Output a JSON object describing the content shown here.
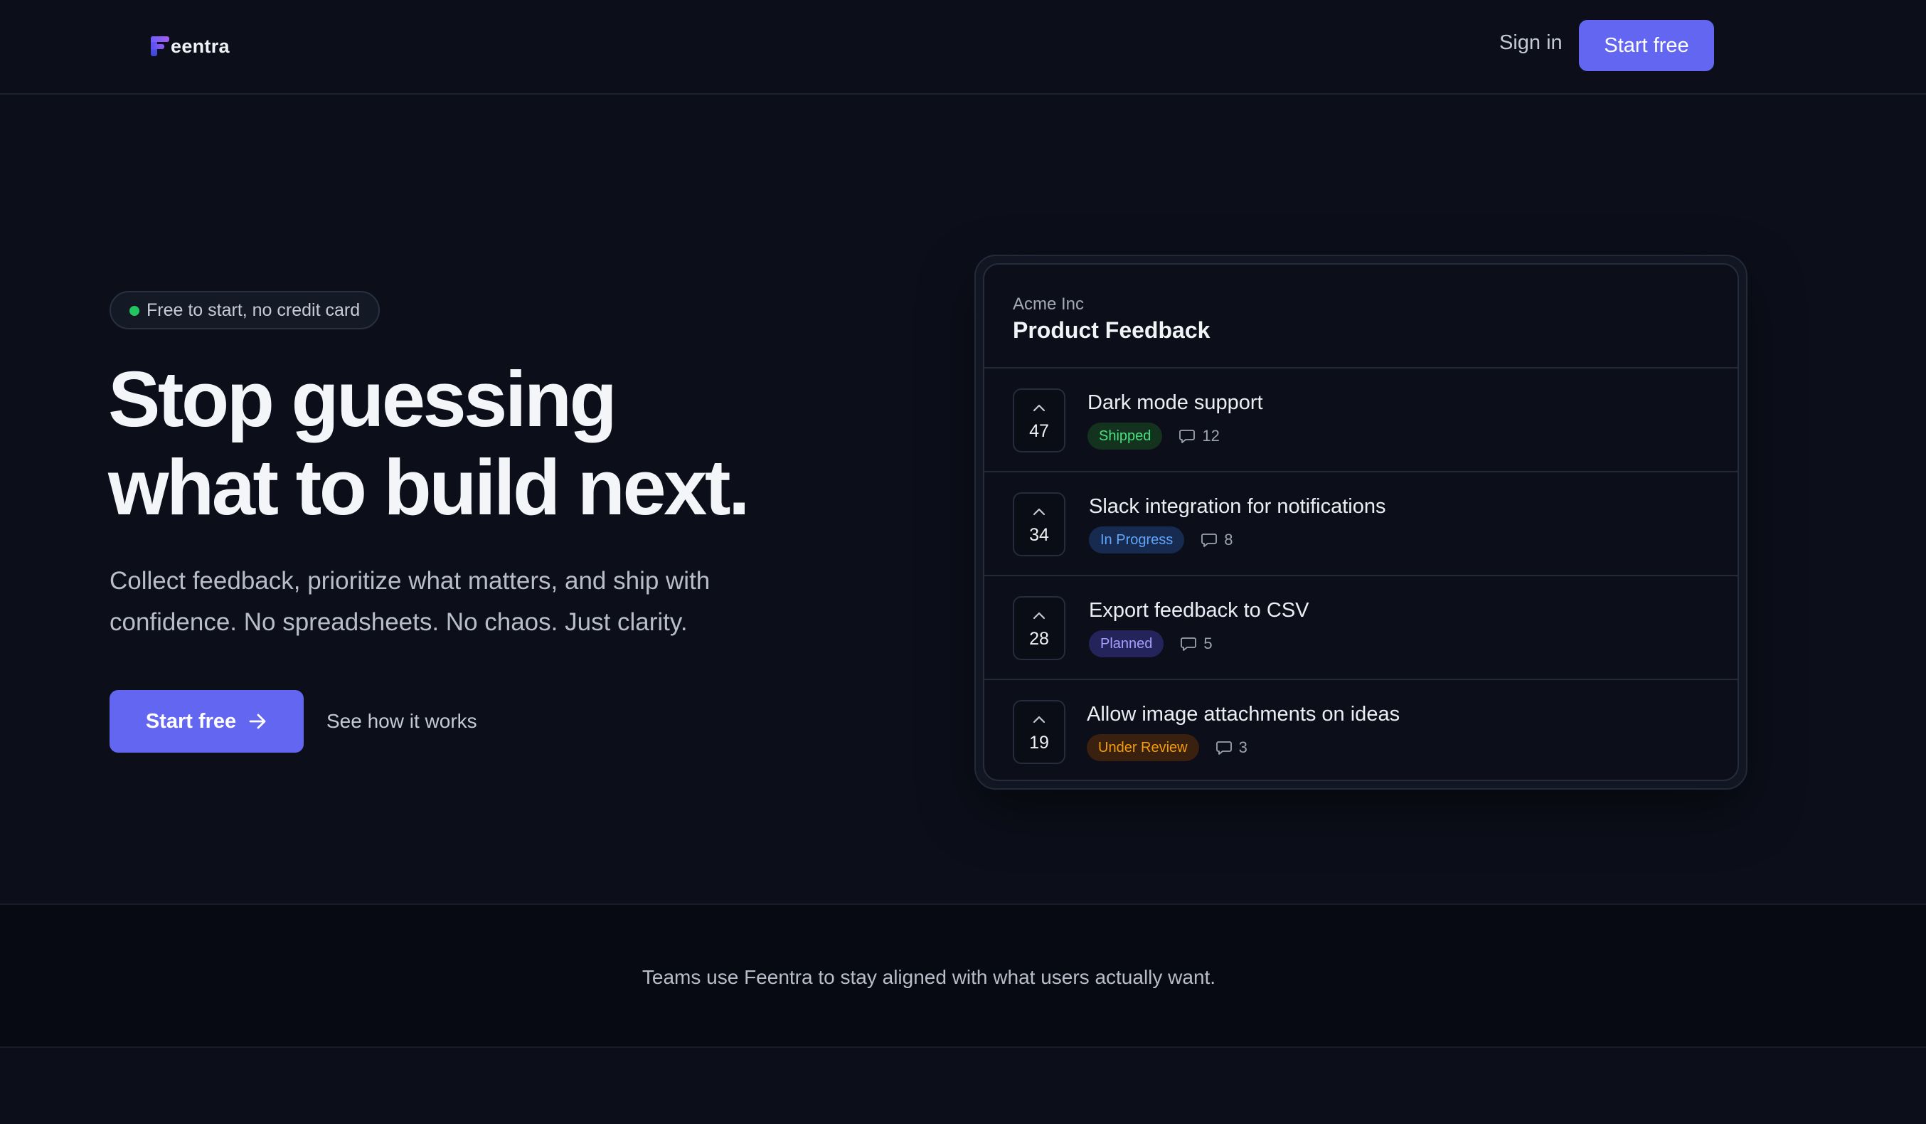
{
  "nav": {
    "brand": "eentra",
    "sign_in": "Sign in",
    "cta": "Start free"
  },
  "hero": {
    "pill": "Free to start, no credit card",
    "headline_line1": "Stop guessing",
    "headline_line2": "what to build next.",
    "sub_line1": "Collect feedback, prioritize what matters, and ship with",
    "sub_line2": "confidence. No spreadsheets. No chaos. Just clarity.",
    "cta": "Start free",
    "secondary": "See how it works"
  },
  "board": {
    "org": "Acme Inc",
    "title": "Product Feedback",
    "items": [
      {
        "votes": "47",
        "title": "Dark mode support",
        "status": "Shipped",
        "comments": "12"
      },
      {
        "votes": "34",
        "title": "Slack integration for notifications",
        "status": "In Progress",
        "comments": "8"
      },
      {
        "votes": "28",
        "title": "Export feedback to CSV",
        "status": "Planned",
        "comments": "5"
      },
      {
        "votes": "19",
        "title": "Allow image attachments on ideas",
        "status": "Under Review",
        "comments": "3"
      }
    ]
  },
  "band": {
    "text": "Teams use Feentra to stay aligned with what users actually want."
  },
  "colors": {
    "background": "#0c0f1a",
    "accent": "#6366f1",
    "shipped": "#4ade80",
    "in_progress": "#60a5fa",
    "planned": "#a5a0ff",
    "under_review": "#f59e0b"
  },
  "icons": [
    "logo-f-icon",
    "arrow-right-icon",
    "chevron-up-icon",
    "comment-icon",
    "status-dot-icon"
  ]
}
